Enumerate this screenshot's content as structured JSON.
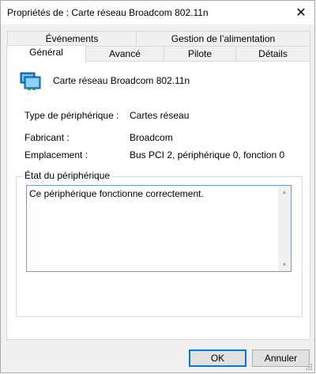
{
  "window": {
    "title": "Propriétés de : Carte réseau Broadcom 802.11n",
    "close_glyph": "✕"
  },
  "tabs": {
    "row1": [
      "Événements",
      "Gestion de l’alimentation"
    ],
    "row2": [
      "Général",
      "Avancé",
      "Pilote",
      "Détails"
    ],
    "active": "Général"
  },
  "device": {
    "name": "Carte réseau Broadcom 802.11n",
    "icon": "network-adapter-icon"
  },
  "properties": [
    {
      "label": "Type de périphérique :",
      "value": "Cartes réseau"
    },
    {
      "label": "Fabricant :",
      "value": "Broadcom"
    },
    {
      "label": "Emplacement :",
      "value": "Bus PCI 2, périphérique 0, fonction 0"
    }
  ],
  "status": {
    "group_title": "État du périphérique",
    "text": "Ce périphérique fonctionne correctement.",
    "scroll_up_glyph": "▲",
    "scroll_down_glyph": "▼"
  },
  "buttons": {
    "ok": "OK",
    "cancel": "Annuler"
  },
  "colors": {
    "dialog_bg": "#f0f0f0",
    "panel_bg": "#ffffff",
    "focus_border": "#0078d7"
  }
}
